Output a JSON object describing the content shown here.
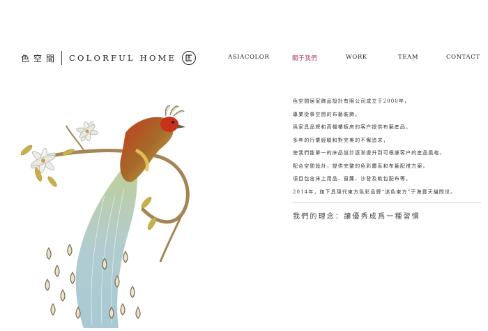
{
  "header": {
    "logo": {
      "cn": "色空間",
      "en": "COLORFUL HOME",
      "seal_icon": "seal-logo-icon"
    },
    "nav": [
      {
        "label": "ASIACOLOR",
        "active": false
      },
      {
        "label": "關于我們",
        "active": true
      },
      {
        "label": "WORK",
        "active": false
      },
      {
        "label": "TEAM",
        "active": false
      },
      {
        "label": "CONTACT",
        "active": false
      }
    ]
  },
  "illustration": {
    "subject": "embroidered bird of paradise on branch with flowers"
  },
  "about": {
    "paragraphs": [
      "色空間居家飾品設計有限公司成立于2000年，",
      "專業從事空間的布藝裝飾。",
      "爲家具品牌和高檔樓板房的客户提供布藝産品。",
      "多年的行業經驗和對完美的不懈追求，",
      "使我們能單一的床品設計逐漸提升到可根據客户的産品風格，",
      "配合空間設計，提供完整的色彩體系和布藝配搭方案，",
      "項目包含床上用品、窗簾、沙發及軟包配布等。",
      "2014年，旗下具現代東方色彩品牌“迷色東方”于海寶天貓問世。"
    ],
    "philosophy": "我們的理念：讓優秀成爲一種習慣"
  },
  "colors": {
    "accent": "#b0426e",
    "text": "#333333",
    "divider": "#cfcfcf",
    "background": "#ffffff"
  }
}
